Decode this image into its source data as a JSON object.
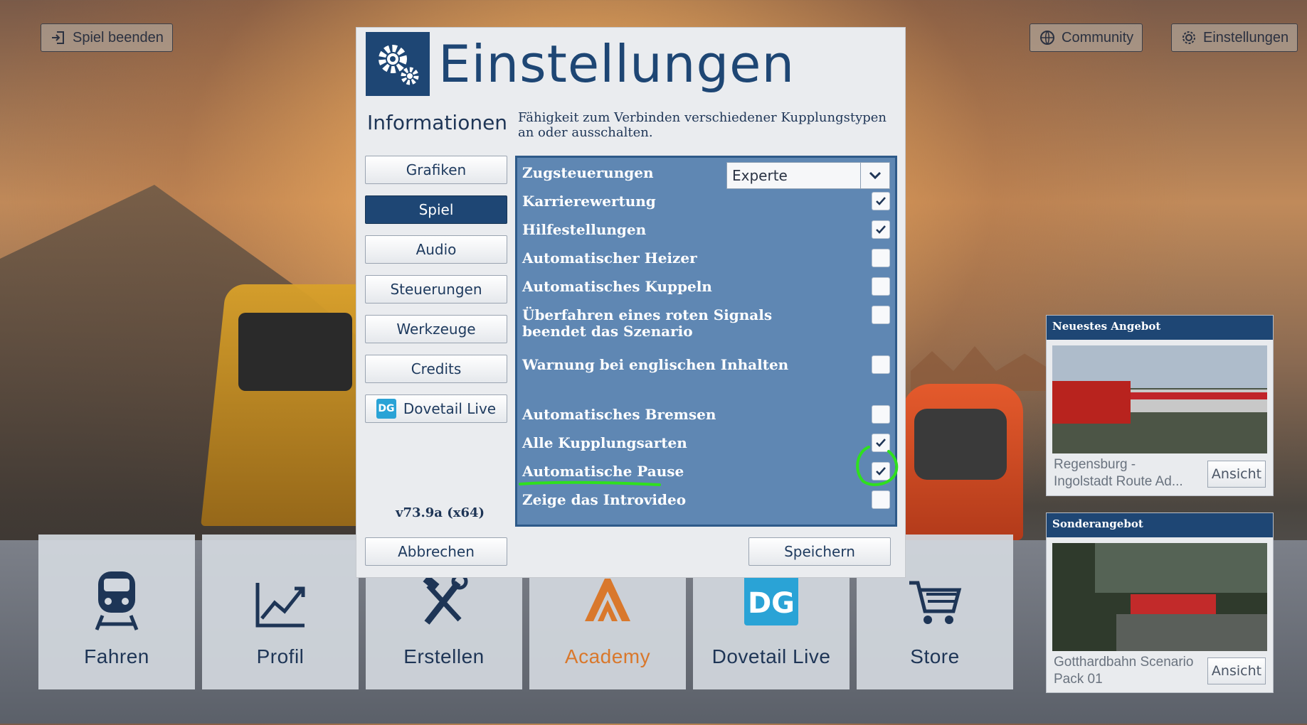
{
  "top_bar": {
    "quit_label": "Spiel beenden",
    "community_label": "Community",
    "settings_label": "Einstellungen"
  },
  "dialog": {
    "title": "Einstellungen",
    "section_label": "Informationen",
    "description": "Fähigkeit zum Verbinden verschiedener Kupplungstypen an oder ausschalten.",
    "nav": [
      {
        "label": "Grafiken",
        "active": false
      },
      {
        "label": "Spiel",
        "active": true
      },
      {
        "label": "Audio",
        "active": false
      },
      {
        "label": "Steuerungen",
        "active": false
      },
      {
        "label": "Werkzeuge",
        "active": false
      },
      {
        "label": "Credits",
        "active": false
      },
      {
        "label": "Dovetail Live",
        "active": false
      }
    ],
    "version": "v73.9a (x64)",
    "train_controls": {
      "label": "Zugsteuerungen",
      "value": "Experte"
    },
    "settings": [
      {
        "label": "Karrierewertung",
        "checked": true
      },
      {
        "label": "Hilfestellungen",
        "checked": true
      },
      {
        "label": "Automatischer Heizer",
        "checked": false
      },
      {
        "label": "Automatisches Kuppeln",
        "checked": false
      },
      {
        "label": "Überfahren eines roten Signals beendet das Szenario",
        "checked": false
      },
      {
        "label": "Warnung bei englischen Inhalten",
        "checked": false
      },
      {
        "label": "Automatisches Bremsen",
        "checked": false
      },
      {
        "label": "Alle Kupplungsarten",
        "checked": true
      },
      {
        "label": "Automatische Pause",
        "checked": true
      },
      {
        "label": "Zeige das Introvideo",
        "checked": false
      }
    ],
    "cancel_label": "Abbrechen",
    "save_label": "Speichern"
  },
  "tiles": [
    {
      "label": "Fahren",
      "icon": "train-icon"
    },
    {
      "label": "Profil",
      "icon": "chart-icon"
    },
    {
      "label": "Erstellen",
      "icon": "tools-icon"
    },
    {
      "label": "Academy",
      "icon": "academy-icon"
    },
    {
      "label": "Dovetail Live",
      "icon": "dovetail-live-icon"
    },
    {
      "label": "Store",
      "icon": "cart-icon"
    }
  ],
  "offers": [
    {
      "header": "Neuestes Angebot",
      "name": "Regensburg - Ingolstadt Route Ad...",
      "button": "Ansicht"
    },
    {
      "header": "Sonderangebot",
      "name": "Gotthardbahn Scenario Pack 01",
      "button": "Ansicht"
    }
  ],
  "colors": {
    "primary": "#1e4674",
    "panel": "#5f87b3",
    "academy": "#d9782c",
    "annotation": "#2fe01e"
  }
}
